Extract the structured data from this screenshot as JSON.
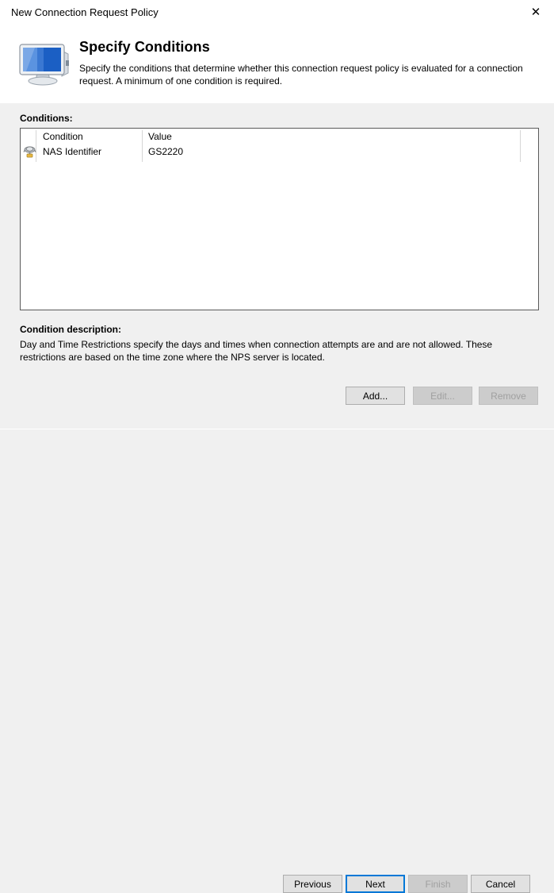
{
  "window": {
    "title": "New Connection Request Policy",
    "close_label": "✕"
  },
  "header": {
    "icon": "computer-monitor-icon",
    "title": "Specify Conditions",
    "description": "Specify the conditions that determine whether this connection request policy is evaluated for a connection request. A minimum of one condition is required."
  },
  "conditions": {
    "label": "Conditions:",
    "columns": [
      {
        "key": "condition",
        "label": "Condition"
      },
      {
        "key": "value",
        "label": "Value"
      }
    ],
    "rows": [
      {
        "icon": "nas-identifier-icon",
        "condition": "NAS Identifier",
        "value": "GS2220"
      }
    ]
  },
  "condition_description": {
    "label": "Condition description:",
    "text": "Day and Time Restrictions specify the days and times when connection attempts are and are not allowed. These restrictions are based on the time zone where the NPS server is located."
  },
  "list_actions": {
    "add_label": "Add...",
    "edit_label": "Edit...",
    "remove_label": "Remove"
  },
  "footer": {
    "previous_label": "Previous",
    "next_label": "Next",
    "finish_label": "Finish",
    "cancel_label": "Cancel"
  },
  "colors": {
    "dialog_background": "#f0f0f0",
    "header_background": "#ffffff",
    "listview_background": "#ffffff",
    "listview_border": "#5a5a5a",
    "focus_accent": "#0078d7",
    "button_face": "#e1e1e1",
    "button_border": "#adadad",
    "disabled_text": "#a0a0a0",
    "text": "#000000"
  }
}
